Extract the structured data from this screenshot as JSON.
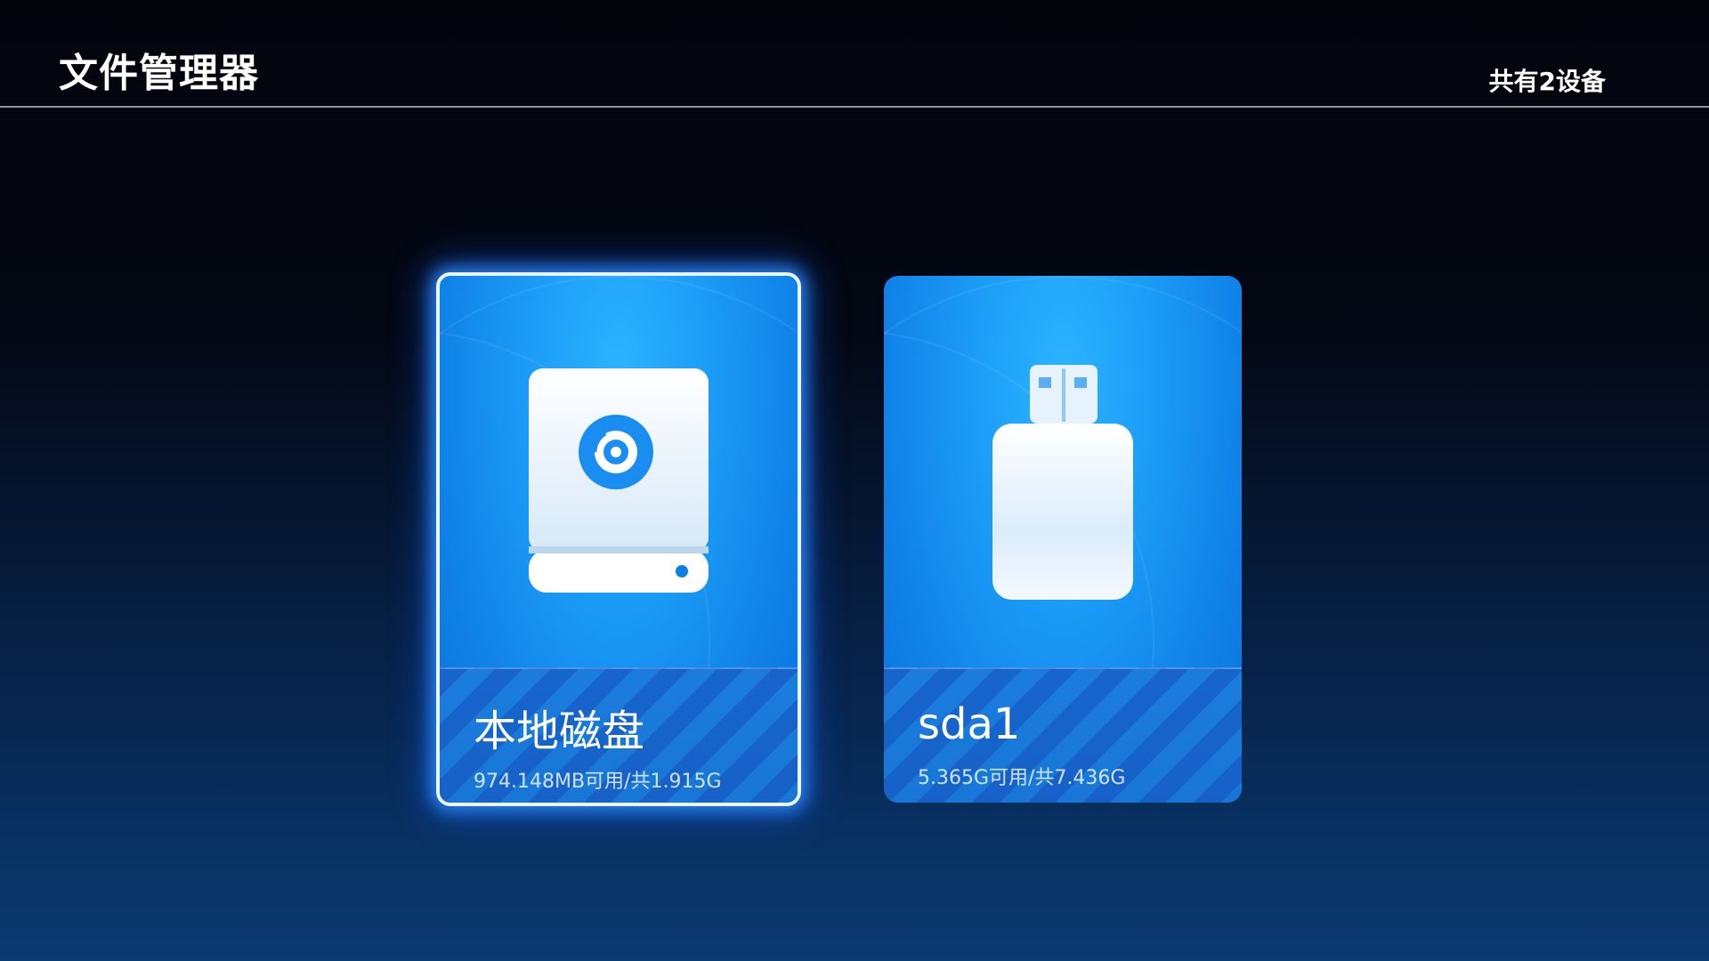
{
  "header": {
    "title": "文件管理器",
    "device_count": "共有2设备"
  },
  "devices": [
    {
      "name": "本地磁盘",
      "space": "974.148MB可用/共1.915G",
      "icon": "hard-disk-icon",
      "selected": true
    },
    {
      "name": "sda1",
      "space": "5.365G可用/共7.436G",
      "icon": "usb-drive-icon",
      "selected": false
    }
  ],
  "colors": {
    "card_blue": "#1a99f5",
    "focus_glow": "#2e8cff",
    "background_top": "#03050d",
    "background_bottom": "#0a3b73"
  }
}
